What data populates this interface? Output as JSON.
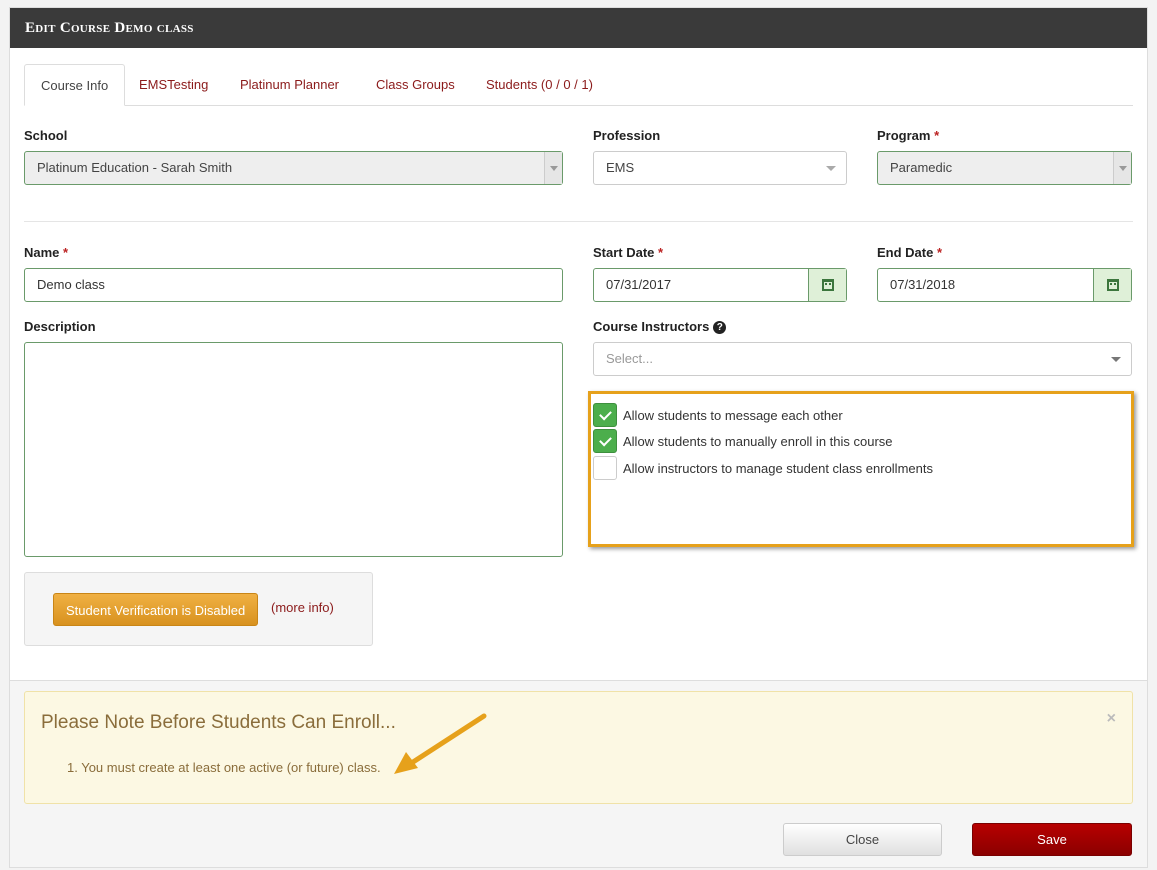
{
  "modal": {
    "title": "Edit Course Demo class"
  },
  "tabs": [
    {
      "label": "Course Info",
      "active": true
    },
    {
      "label": "EMSTesting"
    },
    {
      "label": "Platinum Planner"
    },
    {
      "label": "Class Groups"
    },
    {
      "label": "Students (0 / 0 / 1)"
    }
  ],
  "school": {
    "label": "School",
    "value": "Platinum Education - Sarah Smith"
  },
  "profession": {
    "label": "Profession",
    "value": "EMS"
  },
  "program": {
    "label": "Program",
    "required": "*",
    "value": "Paramedic"
  },
  "name": {
    "label": "Name",
    "required": "*",
    "value": "Demo class"
  },
  "start_date": {
    "label": "Start Date",
    "required": "*",
    "value": "07/31/2017"
  },
  "end_date": {
    "label": "End Date",
    "required": "*",
    "value": "07/31/2018"
  },
  "description": {
    "label": "Description",
    "value": ""
  },
  "instructors": {
    "label": "Course Instructors",
    "help": "?",
    "placeholder": "Select..."
  },
  "options": [
    {
      "label": "Allow students to message each other",
      "checked": true
    },
    {
      "label": "Allow students to manually enroll in this course",
      "checked": true
    },
    {
      "label": "Allow instructors to manage student class enrollments",
      "checked": false
    }
  ],
  "verification": {
    "button": "Student Verification is Disabled",
    "link": "(more info)"
  },
  "alert": {
    "title": "Please Note Before Students Can Enroll...",
    "item": "1. You must create at least one active (or future) class.",
    "close": "×"
  },
  "footer": {
    "close_label": "Close",
    "save_label": "Save"
  },
  "colors": {
    "header_bg": "#3a3a3a",
    "link": "#8b1a1a",
    "save": "#a30000",
    "highlight": "#e6a11b",
    "check": "#4cae4c"
  }
}
